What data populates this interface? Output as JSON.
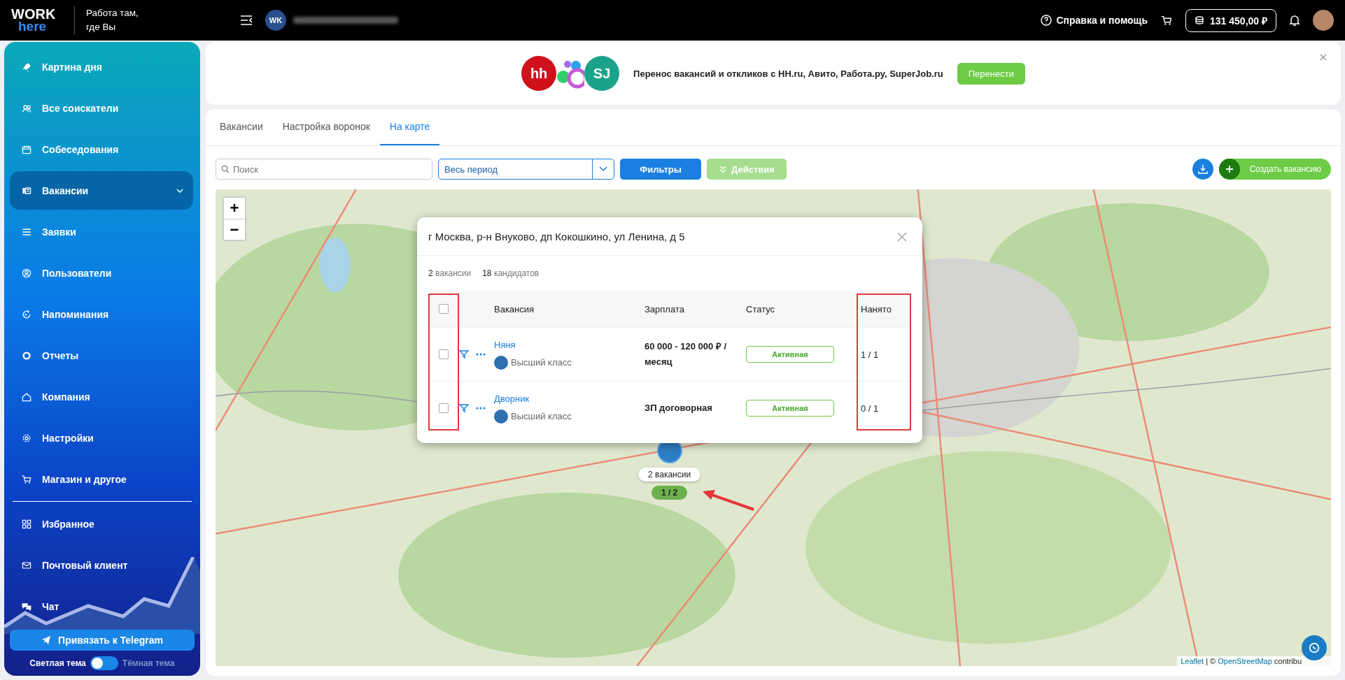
{
  "header": {
    "logo": {
      "top": "WORK",
      "bottom": "here"
    },
    "tagline": [
      "Работа там,",
      "где Вы"
    ],
    "account_initials": "WK",
    "help": "Справка и помощь",
    "balance": "131 450,00 ₽"
  },
  "sidebar": {
    "items": [
      {
        "label": "Картина дня",
        "selected": false,
        "has_submenu": false
      },
      {
        "label": "Все соискатели",
        "selected": false,
        "has_submenu": false
      },
      {
        "label": "Собеседования",
        "selected": false,
        "has_submenu": false
      },
      {
        "label": "Вакансии",
        "selected": true,
        "has_submenu": true
      },
      {
        "label": "Заявки",
        "selected": false,
        "has_submenu": false
      },
      {
        "label": "Пользователи",
        "selected": false,
        "has_submenu": false
      },
      {
        "label": "Напоминания",
        "selected": false,
        "has_submenu": false
      },
      {
        "label": "Отчеты",
        "selected": false,
        "has_submenu": false
      },
      {
        "label": "Компания",
        "selected": false,
        "has_submenu": false
      },
      {
        "label": "Настройки",
        "selected": false,
        "has_submenu": false
      },
      {
        "label": "Магазин и другое",
        "selected": false,
        "has_submenu": false
      }
    ],
    "extra_items": [
      {
        "label": "Избранное",
        "selected": false,
        "has_submenu": false
      },
      {
        "label": "Почтовый клиент",
        "selected": false,
        "has_submenu": false
      },
      {
        "label": "Чат",
        "selected": false,
        "has_submenu": false
      }
    ],
    "telegram_button": "Привязать к Telegram",
    "theme": {
      "light_label": "Светлая тема",
      "dark_label": "Тёмная тема",
      "dark": false
    }
  },
  "banner": {
    "logos": [
      "hh",
      "SJ"
    ],
    "text": "Перенос вакансий и откликов с HH.ru, Авито, Работа.ру, SuperJob.ru",
    "button": "Перенести"
  },
  "tabs": [
    {
      "label": "Вакансии",
      "selected": false
    },
    {
      "label": "Настройка воронок",
      "selected": false
    },
    {
      "label": "На карте",
      "selected": true
    }
  ],
  "toolbar": {
    "search": {
      "placeholder": "Поиск"
    },
    "period": "Весь период",
    "filters": "Фильтры",
    "actions": {
      "label": "Действия",
      "disabled": true
    },
    "create": "Создать вакансию"
  },
  "map": {
    "zoom_in": "+",
    "zoom_out": "−",
    "attribution": {
      "leaflet": "Leaflet",
      "separator": "| ©",
      "osm": "OpenStreetMap",
      "rest": "contribu"
    },
    "marker": {
      "label": "2 вакансии",
      "hired": "1 / 2"
    },
    "popup": {
      "title": "г Москва, р-н Внуково, дп Кокошкино, ул Ленина, д 5",
      "stats": [
        {
          "count": "2",
          "label": "вакансии"
        },
        {
          "count": "18",
          "label": "кандидатов"
        }
      ],
      "columns": [
        "Вакансия",
        "Зарплата",
        "Статус",
        "Нанято"
      ],
      "all_checked": false,
      "rows": [
        {
          "checked": false,
          "title": "Няня",
          "company": "Высший класс",
          "salary": "60 000 - 120 000 ₽ / месяц",
          "status": "Активная",
          "hired": "1 / 1"
        },
        {
          "checked": false,
          "title": "Дворник",
          "company": "Высший класс",
          "salary": "ЗП договорная",
          "status": "Активная",
          "hired": "0 / 1"
        }
      ]
    }
  }
}
